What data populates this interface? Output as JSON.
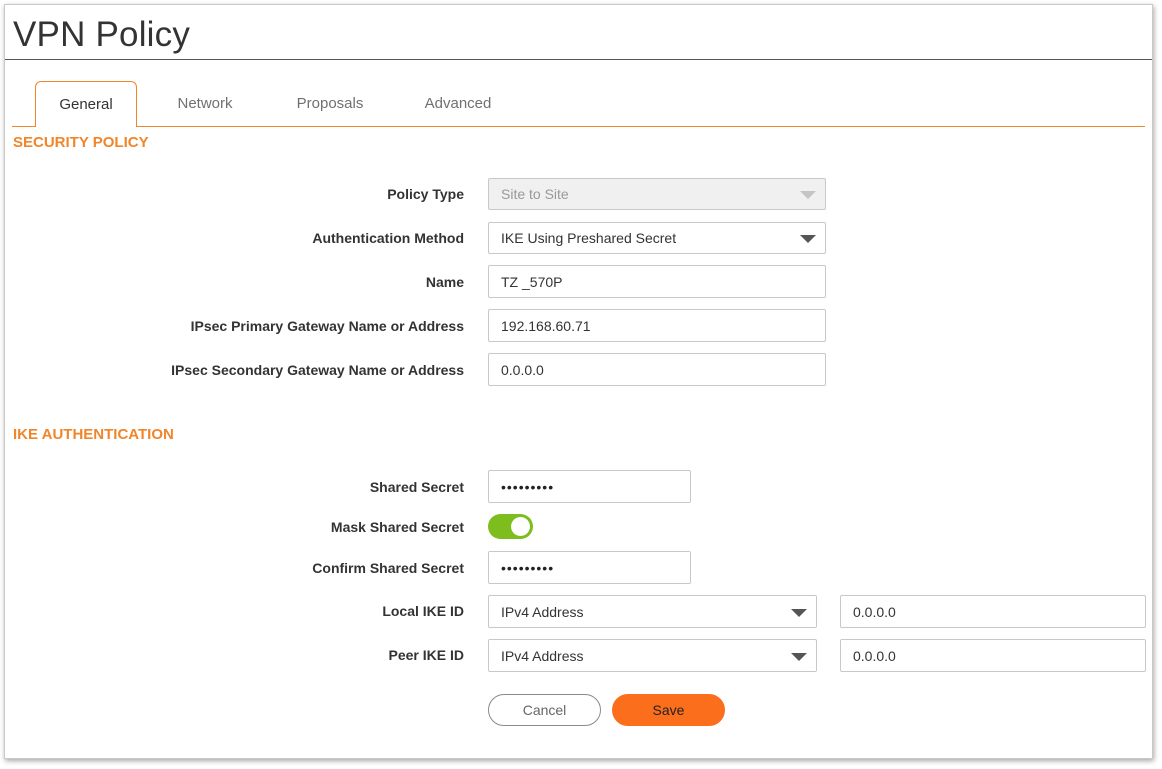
{
  "window": {
    "title": "VPN Policy"
  },
  "tabs": [
    {
      "label": "General",
      "active": true
    },
    {
      "label": "Network",
      "active": false
    },
    {
      "label": "Proposals",
      "active": false
    },
    {
      "label": "Advanced",
      "active": false
    }
  ],
  "security_policy": {
    "heading": "SECURITY POLICY",
    "policy_type": {
      "label": "Policy Type",
      "value": "Site to Site",
      "disabled": true
    },
    "auth_method": {
      "label": "Authentication Method",
      "value": "IKE Using Preshared Secret"
    },
    "name": {
      "label": "Name",
      "value": "TZ _570P"
    },
    "primary_gateway": {
      "label": "IPsec Primary Gateway Name or Address",
      "value": "192.168.60.71"
    },
    "secondary_gateway": {
      "label": "IPsec Secondary Gateway Name or Address",
      "value": "0.0.0.0"
    }
  },
  "ike_auth": {
    "heading": "IKE AUTHENTICATION",
    "shared_secret": {
      "label": "Shared Secret",
      "masked_value": "•••••••••"
    },
    "mask_shared_secret": {
      "label": "Mask Shared Secret",
      "enabled": true
    },
    "confirm_secret": {
      "label": "Confirm Shared Secret",
      "masked_value": "•••••••••"
    },
    "local_ike_id": {
      "label": "Local IKE ID",
      "type": "IPv4 Address",
      "value": "0.0.0.0"
    },
    "peer_ike_id": {
      "label": "Peer IKE ID",
      "type": "IPv4 Address",
      "value": "0.0.0.0"
    }
  },
  "actions": {
    "cancel_label": "Cancel",
    "save_label": "Save"
  },
  "colors": {
    "accent": "#f0852a",
    "toggle_on": "#7dbd1d",
    "save_button": "#fb6e1c"
  },
  "icons": {
    "dropdown": "caret-down-icon",
    "toggle": "toggle-switch"
  }
}
